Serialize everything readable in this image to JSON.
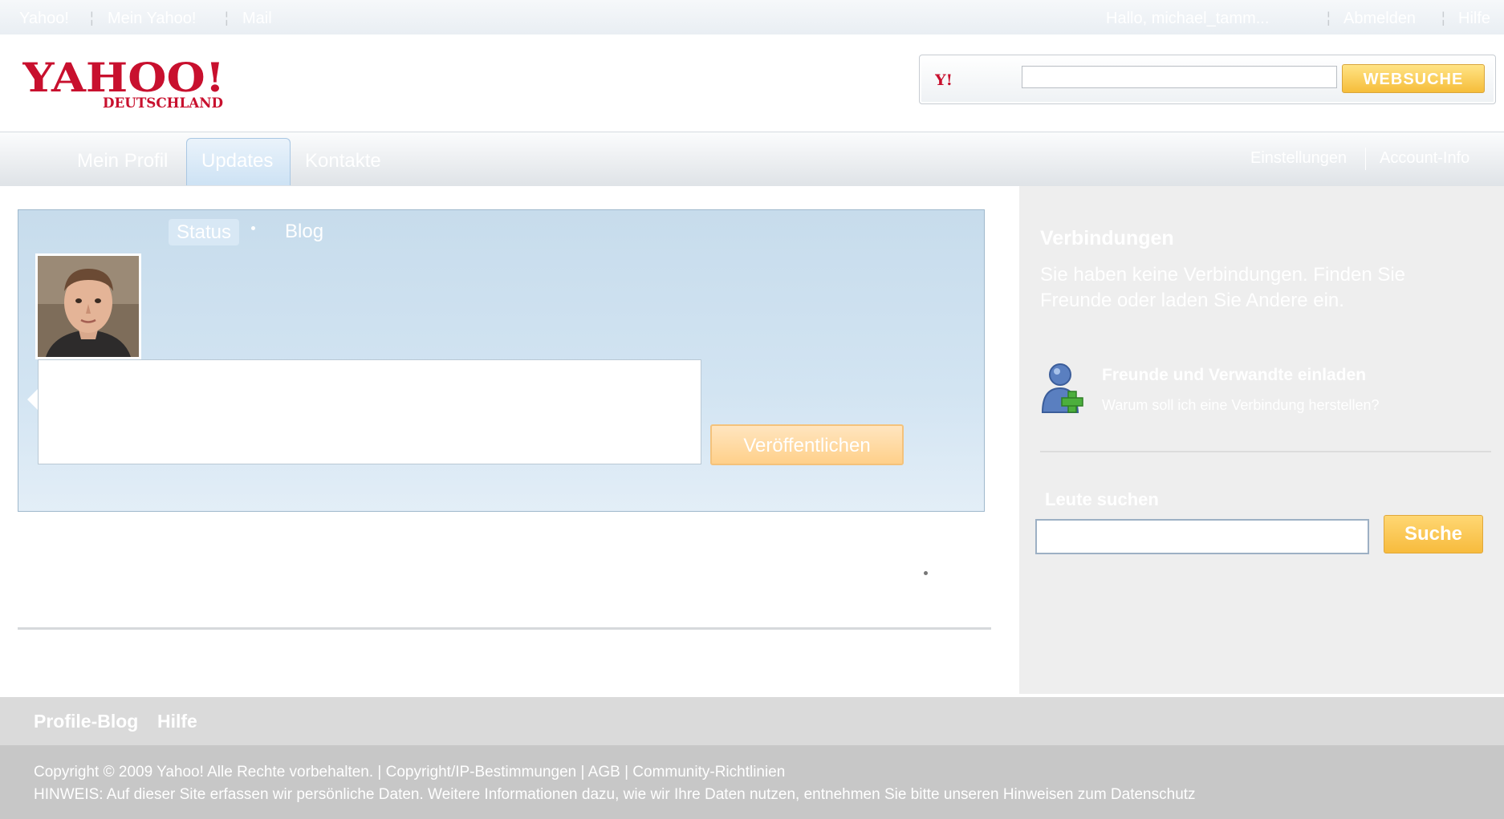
{
  "topbar": {
    "left_links": [
      "Yahoo!",
      "Mein Yahoo!",
      "Mail"
    ],
    "greeting": "Hallo, michael_tamm...",
    "signout": "Abmelden",
    "help": "Hilfe"
  },
  "header": {
    "logo_text": "YAHOO!",
    "logo_subtext": "DEUTSCHLAND",
    "search": {
      "value": "",
      "button_label": "WEBSUCHE"
    }
  },
  "nav": {
    "tabs": [
      "Mein Profil",
      "Updates",
      "Kontakte"
    ],
    "active_tab": "Updates",
    "right_links": [
      "Einstellungen",
      "Account-Info"
    ]
  },
  "composer": {
    "tabs": [
      "Status",
      "Blog"
    ],
    "active_tab": "Status",
    "textarea_value": "",
    "publish_label": "Veröffentlichen"
  },
  "sidebar": {
    "title": "Verbindungen",
    "text": "Sie haben keine Verbindungen. Finden Sie Freunde oder laden Sie Andere ein.",
    "invite_link": "Freunde und Verwandte einladen",
    "invite_sub": "Warum soll ich eine Verbindung herstellen?",
    "people_title": "Leute suchen",
    "people_value": "",
    "people_button": "Suche"
  },
  "footer": {
    "links": [
      "Profile-Blog",
      "Hilfe"
    ],
    "copyright": "Copyright © 2009 Yahoo! Alle Rechte vorbehalten. | Copyright/IP-Bestimmungen | AGB | Community-Richtlinien",
    "notice": "HINWEIS: Auf dieser Site erfassen wir persönliche Daten. Weitere Informationen dazu, wie wir Ihre Daten nutzen, entnehmen Sie bitte unseren Hinweisen zum Datenschutz"
  },
  "colors": {
    "brand_red": "#c8102e",
    "button_yellow": "#f6bd3a",
    "panel_blue": "#c7dcec",
    "sidebar_gray": "#eeeeee"
  }
}
